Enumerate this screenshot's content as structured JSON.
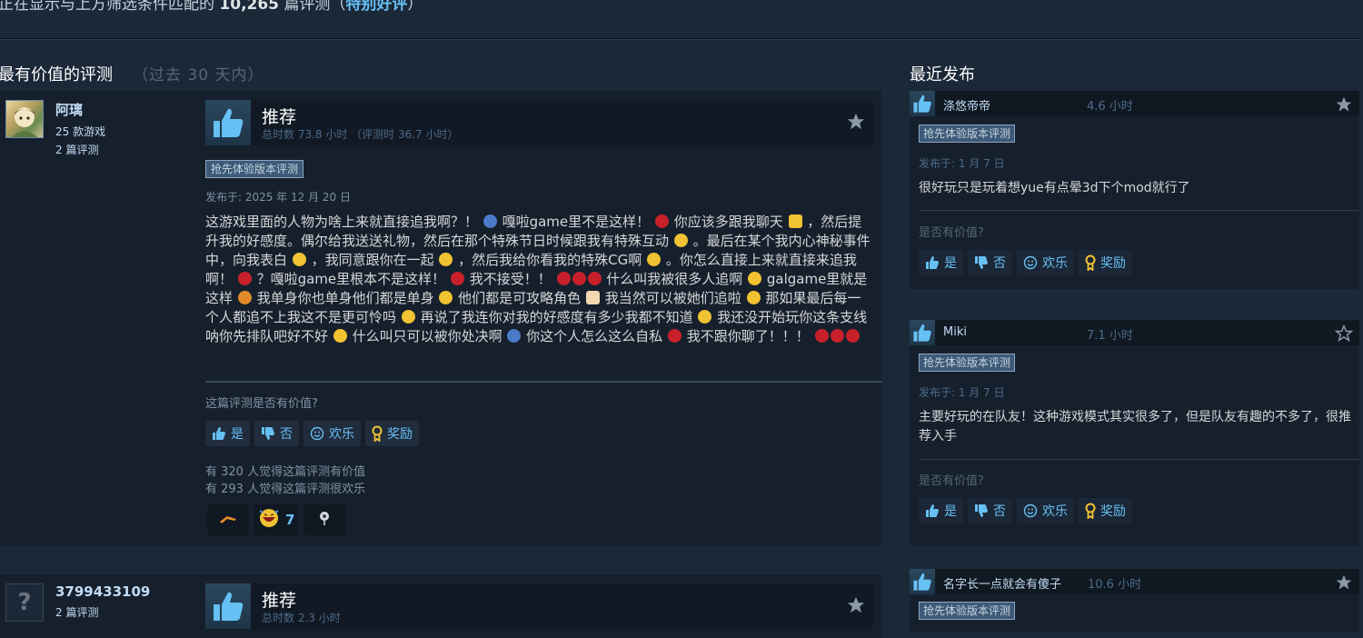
{
  "summary": {
    "prefix": "正在显示与上方筛选条件匹配的",
    "count": "10,265",
    "middle": "篇评测（",
    "rating": "特别好评",
    "suffix": "）"
  },
  "most_helpful": {
    "title": "最有价值的评测",
    "period": "（过去 30 天内）"
  },
  "recent_title": "最近发布",
  "reviews": [
    {
      "author": "阿璃",
      "games": "25 款游戏",
      "review_count": "2 篇评测",
      "verdict": "推荐",
      "hours": "总时数 73.8 小时 （评测时 36.7 小时）",
      "badge": "抢先体验版本评测",
      "posted": "发布于: 2025 年 12 月 20 日",
      "segments": [
        "这游戏里面的人物为啥上来就直接追我啊？！",
        "嘎啦game里不是这样！",
        "你应该多跟我聊天",
        "，然后提升我的好感度。偶尔给我送送礼物，然后在那个特殊节日时候跟我有特殊互动",
        "。最后在某个我内心神秘事件中，向我表白",
        "，我同意跟你在一起",
        "，然后我给你看我的特殊CG啊",
        "。你怎么直接上来就直接来追我啊！",
        "？嘎啦game里根本不是这样！",
        "我不接受！！",
        "什么叫我被很多人追啊",
        "galgame里就是这样",
        "我单身你也单身他们都是单身",
        "他们都是可攻略角色",
        "我当然可以被她们追啦",
        "那如果最后每一个人都追不上我这不是更可怜吗",
        "再说了我连你对我的好感度有多少我都不知道",
        "我还没开始玩你这条支线呐你先排队吧好不好",
        "什么叫只可以被你处决啊",
        "你这个人怎么这么自私",
        "我不跟你聊了！！！"
      ],
      "helpful_question": "这篇评测是否有价值?",
      "buttons": {
        "yes": "是",
        "no": "否",
        "funny": "欢乐",
        "award": "奖励"
      },
      "helpful_stat": "有 320 人觉得这篇评测有价值",
      "funny_stat": "有 293 人觉得这篇评测很欢乐",
      "reaction_count": "7"
    },
    {
      "author": "3799433109",
      "review_count": "2 篇评测",
      "verdict": "推荐",
      "hours": "总时数 2.3 小时"
    }
  ],
  "recent": [
    {
      "name": "涤悠帝帝",
      "hours": "4.6 小时",
      "badge": "抢先体验版本评测",
      "posted": "发布于: 1 月 7 日",
      "text": "很好玩只是玩着想yue有点晕3d下个mod就行了",
      "question": "是否有价值?",
      "yes": "是",
      "no": "否",
      "funny": "欢乐",
      "award": "奖励"
    },
    {
      "name": "Miki",
      "hours": "7.1 小时",
      "badge": "抢先体验版本评测",
      "posted": "发布于: 1 月 7 日",
      "text": "主要好玩的在队友！这种游戏模式其实很多了，但是队友有趣的不多了，很推荐入手",
      "question": "是否有价值?",
      "yes": "是",
      "no": "否",
      "funny": "欢乐",
      "award": "奖励"
    },
    {
      "name": "名字长一点就会有傻子",
      "hours": "10.6 小时",
      "badge": "抢先体验版本评测"
    }
  ],
  "colors": {
    "background": "#1b2838",
    "accent": "#66c0f4",
    "card": "#16202d"
  }
}
